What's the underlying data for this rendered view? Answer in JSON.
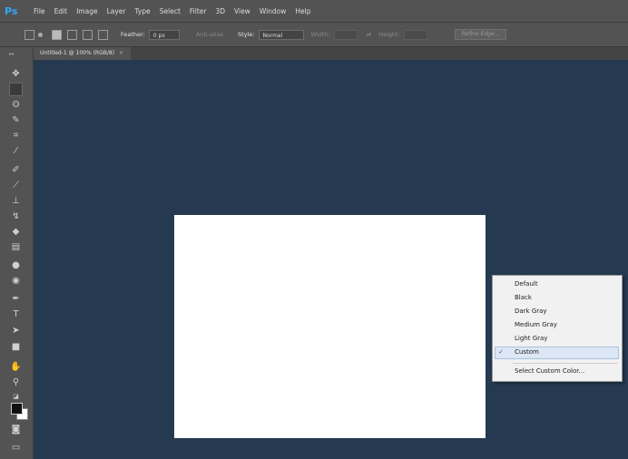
{
  "app": {
    "logo": "Ps"
  },
  "menu": [
    "File",
    "Edit",
    "Image",
    "Layer",
    "Type",
    "Select",
    "Filter",
    "3D",
    "View",
    "Window",
    "Help"
  ],
  "options": {
    "feather_label": "Feather:",
    "feather_value": "0 px",
    "antialias_label": "Anti-alias",
    "style_label": "Style:",
    "style_value": "Normal",
    "width_label": "Width:",
    "height_label": "Height:",
    "refine_edge": "Refine Edge..."
  },
  "document": {
    "tab_title": "Untitled-1 @ 100% (RGB/8)",
    "close_glyph": "×"
  },
  "context_menu": {
    "items": [
      "Default",
      "Black",
      "Dark Gray",
      "Medium Gray",
      "Light Gray",
      "Custom",
      "Select Custom Color..."
    ],
    "checked": "Custom",
    "check_glyph": "✓"
  },
  "colors": {
    "pasteboard": "#253a50",
    "chrome": "#535353",
    "logo": "#31a8ff",
    "highlight": "#dce6f4"
  },
  "tools": [
    "move-icon",
    "marquee-icon",
    "lasso-icon",
    "quick-select-icon",
    "crop-icon",
    "eyedropper-icon",
    "healing-icon",
    "brush-icon",
    "stamp-icon",
    "history-brush-icon",
    "eraser-icon",
    "gradient-icon",
    "blur-icon",
    "dodge-icon",
    "pen-icon",
    "type-icon",
    "path-select-icon",
    "rectangle-icon",
    "hand-icon",
    "zoom-icon"
  ]
}
